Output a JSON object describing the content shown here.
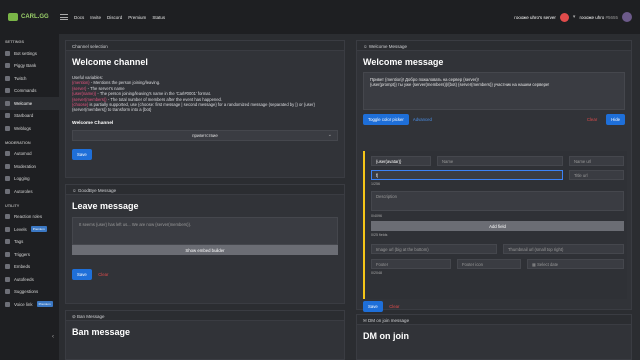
{
  "app": {
    "logo": "CARL.GG"
  },
  "topbar": {
    "links": [
      "Docs",
      "Invite",
      "Discord",
      "Premium",
      "Status"
    ],
    "server_name": "гоооже uhro's server",
    "user_name": "гоооже uhro",
    "user_tag": "#5655"
  },
  "sidebar": {
    "sections": [
      {
        "label": "SETTINGS",
        "items": [
          {
            "label": "Bot settings"
          },
          {
            "label": "Piggy Bank"
          },
          {
            "label": "Twitch"
          },
          {
            "label": "Commands"
          },
          {
            "label": "Welcome",
            "active": true
          },
          {
            "label": "Starboard"
          },
          {
            "label": "Weblogs"
          }
        ]
      },
      {
        "label": "MODERATION",
        "items": [
          {
            "label": "Automod"
          },
          {
            "label": "Moderation"
          },
          {
            "label": "Logging"
          },
          {
            "label": "Autoroles"
          }
        ]
      },
      {
        "label": "UTILITY",
        "items": [
          {
            "label": "Reaction roles"
          },
          {
            "label": "Levels",
            "premium": "Premium"
          },
          {
            "label": "Tags"
          },
          {
            "label": "Triggers"
          },
          {
            "label": "Embeds"
          },
          {
            "label": "Autofeeds"
          },
          {
            "label": "Suggestions"
          },
          {
            "label": "Voice link",
            "premium": "Premium"
          }
        ]
      }
    ],
    "collapse_icon": "‹"
  },
  "left": {
    "channel_header": "Channel selection",
    "welcome_title": "Welcome channel",
    "vars_intro": "Useful variables:",
    "vars": [
      {
        "code": "{mention}",
        "text": " - Mentions the person joining/leaving."
      },
      {
        "code": "{server}",
        "text": " - The server's name"
      },
      {
        "code": "{user(name)}",
        "text": " - The person joining/leaving's name in the 'Carl#0001' format."
      },
      {
        "code": "{server(members)}",
        "text": " - The total number of members after the event has happened."
      },
      {
        "code": "{choose}",
        "text": " is partially supported, use {choose: first message | second message} for a randomized message (separated by |) or {user} (server(members)} to transform into a {bot}"
      }
    ],
    "welcome_channel_label": "Welcome Channel",
    "welcome_channel_value": "приветствие",
    "save": "Save",
    "goodbye_header": "GoodBye Message",
    "leave_title": "Leave message",
    "leave_placeholder": "It seems {user} has left us... We are now {server(members)}.",
    "show_embed": "Show embed builder",
    "clear": "Clear",
    "ban_header": "Ban Message",
    "ban_title": "Ban message"
  },
  "right": {
    "header": "Welcome Message",
    "title": "Welcome message",
    "message_line1": "Привет {mention}! Добро пожаловать на сервер {server}!",
    "message_line2": "{user(prompt)} ты уже {server(members)}/{bot} {server(members)} участник на нашем сервере!",
    "toggle_color": "Toggle color picker",
    "advanced": "Advanced",
    "clear": "Clear",
    "hide": "Hide",
    "author_value": "{user(avatar)}",
    "name_ph": "Name",
    "name_url_ph": "Name url",
    "title_value": "f|",
    "title_url_ph": "Title url",
    "title_count": "1/256",
    "description_ph": "Description",
    "desc_count": "0/4096",
    "add_field": "Add field",
    "fields_count": "0/25 fields",
    "image_url_ph": "Image url (big at the bottom)",
    "thumbnail_ph": "Thumbnail url (small top right)",
    "footer_ph": "Footer",
    "footer_icon_ph": "Footer icon",
    "select_date": "Select date",
    "footer_count": "0/2048",
    "save": "Save",
    "clear2": "Clear",
    "dm_header": "DM on join message",
    "dm_title": "DM on join"
  },
  "colors": {
    "accent": "#1e6fd9",
    "danger": "#e04b4b",
    "embed_bar": "#f5c518",
    "brand": "#7ab547"
  }
}
